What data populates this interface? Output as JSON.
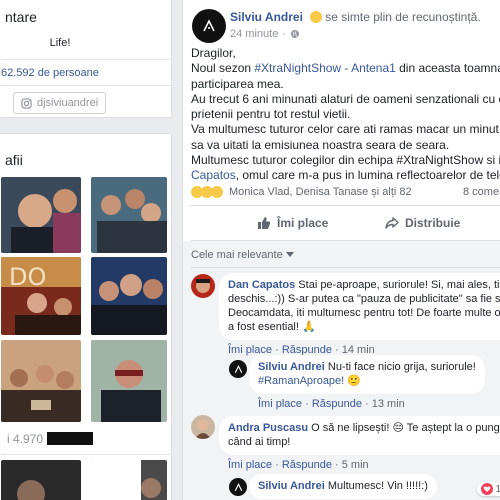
{
  "left": {
    "intro": {
      "title": "ntare",
      "bio": "Life!",
      "followers": "62.592 de persoane",
      "instagram": "djsiviuandrei"
    },
    "photos": {
      "title": "afii"
    },
    "friends": {
      "count": "i 4.970"
    }
  },
  "post": {
    "author": "Silviu Andrei",
    "feeling": "se simte plin de recunoștință.",
    "time": "24 minute",
    "lines": [
      "Dragilor,",
      [
        "Noul sezon ",
        "#XtraNightShow - Antena1",
        " din aceasta toamna va con"
      ],
      "participarea mea.",
      "Au trecut 6 ani minunati alaturi de oameni senzationali cu care am",
      "prietenii pentru tot restul vietii.",
      "Va multumesc tuturor celor care ati ramas macar un minut cu ochii",
      "sa va uitati la emisiunea noastra seara de seara.",
      "Multumesc tuturor colegilor din echipa #XtraNightShow si in specia",
      [
        "Capatos",
        ", omul care m-a pus in lumina reflectoarelor de televi...",
        " Ve"
      ]
    ],
    "reactions_text": "Monica Vlad, Denisa Tanase și alți 82",
    "comments_count": "8 coment",
    "like_label": "Îmi place",
    "share_label": "Distribuie",
    "sort_label": "Cele mai relevante",
    "comments": [
      {
        "author": "Dan Capatos",
        "lines": [
          " Stai pe-aproape, suriorule! Si, mai ales, tine tele",
          "deschis...:)) S-ar putea ca \"pauza de publicitate\" sa fie scurta.",
          "Deocamdata, iti multumesc pentru tot! De foarte multe ori, ajuto",
          "a fost esential! 🙏"
        ],
        "like": "Îmi place",
        "reply": "Răspunde",
        "time": "14 min"
      },
      {
        "author": "Silviu Andrei",
        "lines": [
          " Nu-ti face nicio grija, suriorule!",
          "#RamanAproape! 🙂"
        ],
        "like": "Îmi place",
        "reply": "Răspunde",
        "time": "13 min"
      },
      {
        "author": "Andra Puscasu",
        "lines": [
          " O să ne lipsești! 😔  Te aștept la o pungă de p",
          "când ai timp!"
        ],
        "like": "Îmi place",
        "reply": "Răspunde",
        "time": "5 min"
      },
      {
        "author": "Silviu Andrei",
        "lines": [
          " Multumesc! Vin !!!!!:)"
        ],
        "heart_count": "1"
      }
    ]
  }
}
